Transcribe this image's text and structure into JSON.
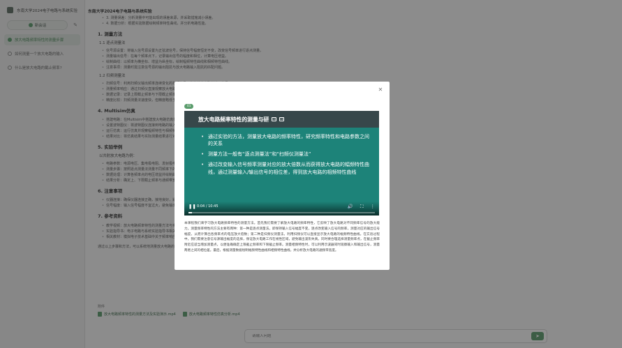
{
  "app": {
    "title": "东南大学2024电子电路与系统实验",
    "new_chat_label": "新会话"
  },
  "sidebar": {
    "items": [
      {
        "label": "放大电路频率特性的测量步骤",
        "active": true
      },
      {
        "label": "如何测量一个放大电路的输入",
        "active": false
      },
      {
        "label": "什么是放大电路的截止频率?",
        "active": false
      }
    ]
  },
  "article": {
    "header_lines": [
      "3. 测量误差：分析测量中可能出现的误差来源，并采取措施减小误差。",
      "4. 数据分析：根据实验数据绘制频率特性曲线，并分析电路性能。"
    ],
    "sections": [
      {
        "title": "1. 测量方法",
        "subsections": [
          {
            "title": "1.1 逐点测量法",
            "items": [
              "信号源设置：将输入信号源设置为正弦波信号，保持信号幅度恒定不变，改变信号频率进行逐点测量。",
              "测量输出信号：在每个频率点下，记录输出信号的幅度和相位，计算电压增益。",
              "绘制曲线：以频率为横坐标、增益为纵坐标，绘制幅频特性曲线和相频特性曲线。",
              "注意事项：测量时需注意信号源的输出阻抗与放大电路输入阻抗的匹配问题。"
            ]
          },
          {
            "title": "1.2 扫频测量法",
            "items": [
              "扫频信号：利用扫频仪输出频率连续变化的扫频信号，作为放大电路的输入信号。",
              "测量频率响应：通过扫频仪直接观察放大电路的频率响应曲线。",
              "数据记录：记录上限截止频率与下限截止频率，计算通频带宽度。",
              "精度比较：扫频测量法速度快，但精度略低于逐点测量法。"
            ]
          }
        ]
      },
      {
        "title": "4. Multisim仿真",
        "subsections": [
          {
            "title": "",
            "items": [
              "搭建电路：在Multisim中搭建放大电路仿真模型，设置元件参数。",
              "设置波特图仪：将波特图仪连接到电路的输入端和输出端。",
              "运行仿真：运行仿真并观察幅频特性与相频特性曲线。",
              "结果对比：将仿真结果与实际测量结果进行对比分析。"
            ]
          }
        ]
      },
      {
        "title": "5. 实验举例",
        "subsections": [
          {
            "title": "以共射放大电路为例：",
            "items": [
              "电路参数：电源电压、集电极电阻、发射极电阻等参数设置。",
              "测量步骤：按照逐点测量法测量不同频率下的输出电压。",
              "数据处理：计算各频率点的电压增益并绘制曲线。",
              "结果分析：确定上、下限截止频率与通频带宽度。"
            ]
          }
        ]
      },
      {
        "title": "6. 注意事项",
        "subsections": [
          {
            "title": "",
            "items": [
              "仪器连接：确保仪器连接正确，接地良好，避免干扰信号。",
              "信号幅度：输入信号幅度不宜过大，避免输出信号失真。"
            ]
          }
        ]
      },
      {
        "title": "7. 参考资料",
        "subsections": [
          {
            "title": "",
            "items": [
              "教学视频：放大电路频率特性的测量方法与实验演示视频。",
              "实验指导书：电子电路与系统实验指导书相关章节。",
              "相关教材：模拟电子技术基础中关于频率响应的章节。"
            ]
          }
        ]
      }
    ],
    "footer_line": "通过以上步骤和方法，可以系统地测量放大电路的频率特性，并对电路性能进行全面的分析和评价。",
    "attach_label": "附件",
    "attachments": [
      "放大电路频率特性的测量方法及实验演示.mp4",
      "放大电路频率特性仿真分析.mp4"
    ]
  },
  "input": {
    "placeholder": "请输入问题"
  },
  "modal": {
    "badge": "01",
    "video": {
      "title": "放大电路频率特性的测量与研",
      "bullets": [
        "通过实验的方法，测量放大电路的频率特性，研究频率特性和电路参数之间的关系",
        "测量方法一般有“逐点测量法”和“扫频仪测量法”",
        "通过改变输入信号频率测量对应的放大倍数从而获得放大电路的幅频特性曲线，通过测量输入/输出信号的相位差，得到放大电路的相频特性曲线"
      ],
      "time": "0:04 / 10:45",
      "progress": 0.02
    },
    "transcript": "本课程我们来学习放大电路频率特性的测量方法。首先我们需要了解放大电路的频率特性，它反映了放大电路对不同频率信号的放大能力。测量频率特性的方法主要有两种：第一种是逐点测量法，即保持输入信号幅度不变，逐点改变输入信号的频率，测量对应的输出信号幅度，从而计算出各频率点的电压放大倍数；第二种是扫频仪测量法，利用扫频仪可以直接显示放大电路的幅频特性曲线。在实验过程中，我们需要注意信号源输出幅度的选择，保证放大电路工作在线性区域，避免输出波形失真。同时要合理选择测量频率点，在截止频率附近应适当增加测量点，以便准确确定上限截止频率和下限截止频率。测量相频特性时，可以利用示波器同时观察输入和输出信号，测量两者之间的相位差。最后，根据测量数据绘制幅频特性曲线和相频特性曲线，并分析放大电路的通频带宽度。"
  }
}
